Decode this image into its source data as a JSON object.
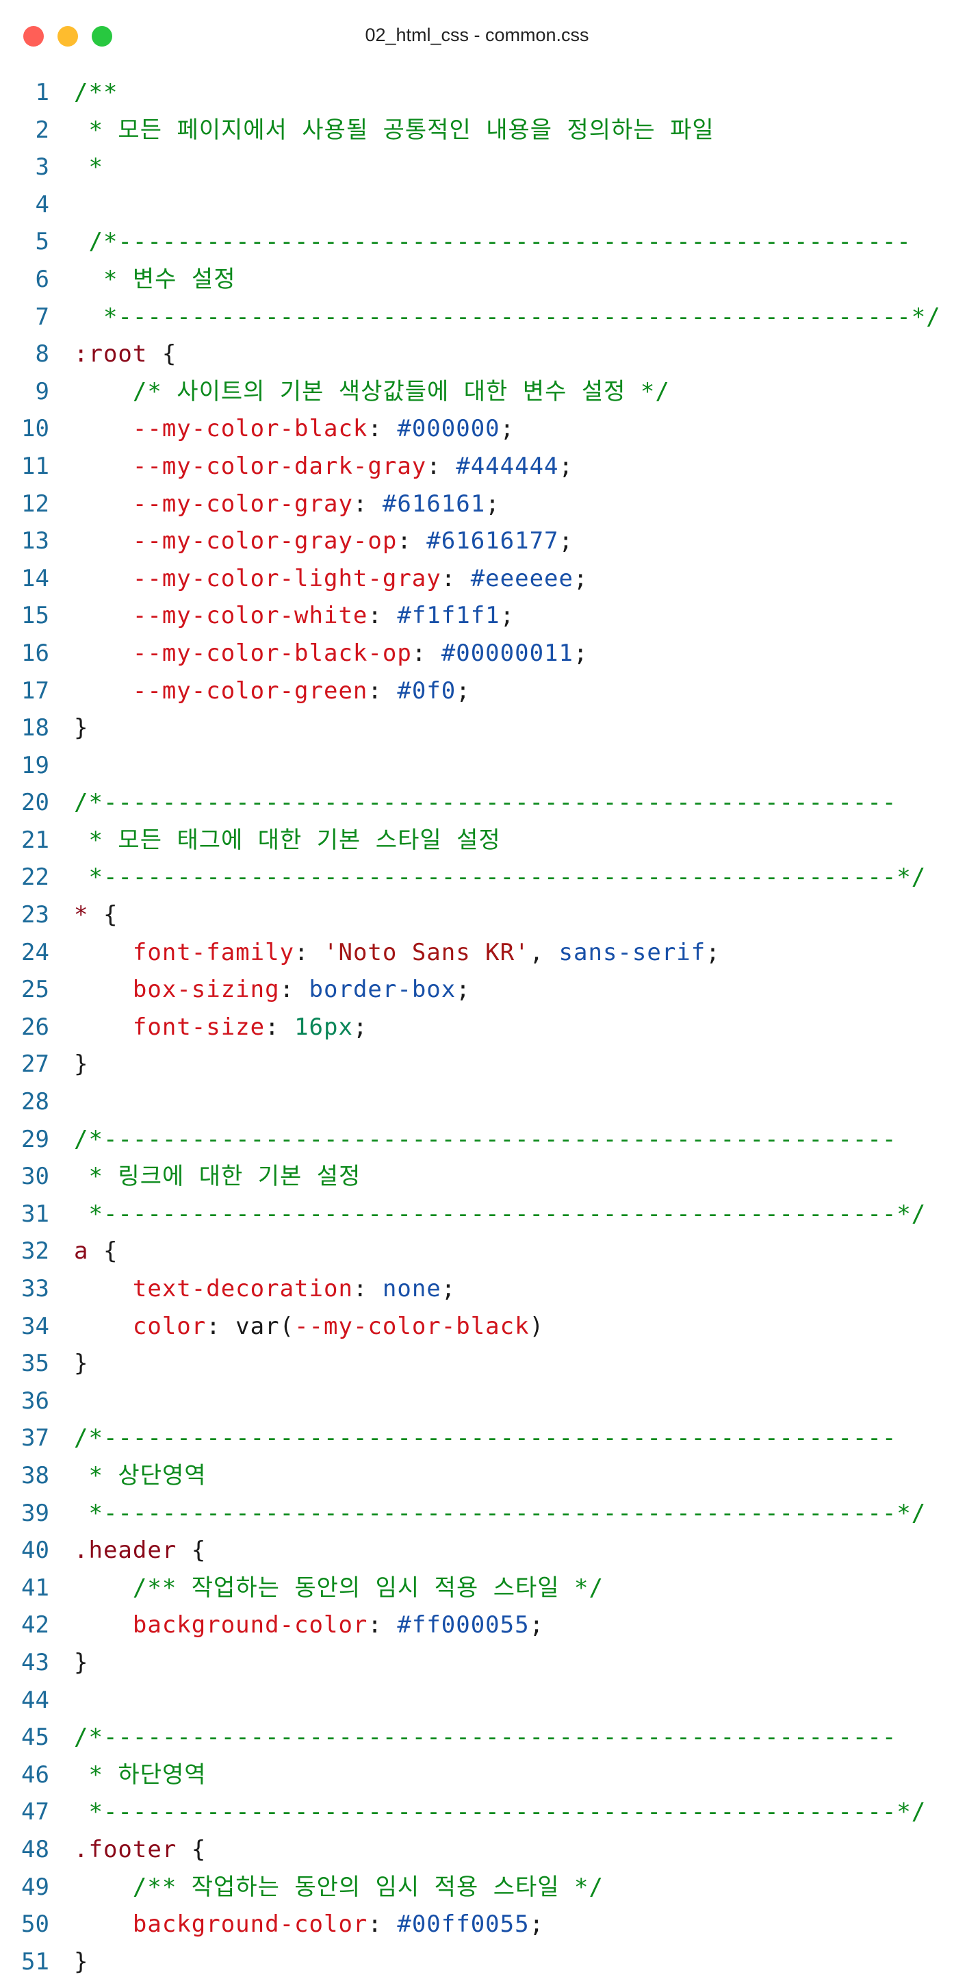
{
  "window": {
    "title": "02_html_css - common.css",
    "controls": [
      {
        "name": "close",
        "color": "#ff5f57"
      },
      {
        "name": "minimize",
        "color": "#febc2e"
      },
      {
        "name": "zoom",
        "color": "#28c840"
      }
    ]
  },
  "token_colors": {
    "line_number": "#1d6b9a",
    "comment": "#0c8a1c",
    "selector": "#8b0a1a",
    "property": "#d1141c",
    "value": "#1850a8",
    "string": "#a31515",
    "number": "#098658",
    "punctuation": "#1a1a1a"
  },
  "lines": [
    {
      "n": "1",
      "tokens": [
        {
          "t": "comment",
          "v": "/**"
        }
      ]
    },
    {
      "n": "2",
      "tokens": [
        {
          "t": "comment",
          "v": " * 모든 페이지에서 사용될 공통적인 내용을 정의하는 파일"
        }
      ]
    },
    {
      "n": "3",
      "tokens": [
        {
          "t": "comment",
          "v": " *"
        }
      ]
    },
    {
      "n": "4",
      "tokens": []
    },
    {
      "n": "5",
      "tokens": [
        {
          "t": "comment",
          "v": " /*------------------------------------------------------"
        }
      ]
    },
    {
      "n": "6",
      "tokens": [
        {
          "t": "comment",
          "v": "  * 변수 설정"
        }
      ]
    },
    {
      "n": "7",
      "tokens": [
        {
          "t": "comment",
          "v": "  *------------------------------------------------------*/"
        }
      ]
    },
    {
      "n": "8",
      "tokens": [
        {
          "t": "selector",
          "v": ":root"
        },
        {
          "t": "punct",
          "v": " {"
        }
      ]
    },
    {
      "n": "9",
      "tokens": [
        {
          "t": "comment",
          "v": "    /* 사이트의 기본 색상값들에 대한 변수 설정 */"
        }
      ]
    },
    {
      "n": "10",
      "tokens": [
        {
          "t": "prop",
          "v": "    --my-color-black"
        },
        {
          "t": "punct",
          "v": ": "
        },
        {
          "t": "value",
          "v": "#000000"
        },
        {
          "t": "punct",
          "v": ";"
        }
      ]
    },
    {
      "n": "11",
      "tokens": [
        {
          "t": "prop",
          "v": "    --my-color-dark-gray"
        },
        {
          "t": "punct",
          "v": ": "
        },
        {
          "t": "value",
          "v": "#444444"
        },
        {
          "t": "punct",
          "v": ";"
        }
      ]
    },
    {
      "n": "12",
      "tokens": [
        {
          "t": "prop",
          "v": "    --my-color-gray"
        },
        {
          "t": "punct",
          "v": ": "
        },
        {
          "t": "value",
          "v": "#616161"
        },
        {
          "t": "punct",
          "v": ";"
        }
      ]
    },
    {
      "n": "13",
      "tokens": [
        {
          "t": "prop",
          "v": "    --my-color-gray-op"
        },
        {
          "t": "punct",
          "v": ": "
        },
        {
          "t": "value",
          "v": "#61616177"
        },
        {
          "t": "punct",
          "v": ";"
        }
      ]
    },
    {
      "n": "14",
      "tokens": [
        {
          "t": "prop",
          "v": "    --my-color-light-gray"
        },
        {
          "t": "punct",
          "v": ": "
        },
        {
          "t": "value",
          "v": "#eeeeee"
        },
        {
          "t": "punct",
          "v": ";"
        }
      ]
    },
    {
      "n": "15",
      "tokens": [
        {
          "t": "prop",
          "v": "    --my-color-white"
        },
        {
          "t": "punct",
          "v": ": "
        },
        {
          "t": "value",
          "v": "#f1f1f1"
        },
        {
          "t": "punct",
          "v": ";"
        }
      ]
    },
    {
      "n": "16",
      "tokens": [
        {
          "t": "prop",
          "v": "    --my-color-black-op"
        },
        {
          "t": "punct",
          "v": ": "
        },
        {
          "t": "value",
          "v": "#00000011"
        },
        {
          "t": "punct",
          "v": ";"
        }
      ]
    },
    {
      "n": "17",
      "tokens": [
        {
          "t": "prop",
          "v": "    --my-color-green"
        },
        {
          "t": "punct",
          "v": ": "
        },
        {
          "t": "value",
          "v": "#0f0"
        },
        {
          "t": "punct",
          "v": ";"
        }
      ]
    },
    {
      "n": "18",
      "tokens": [
        {
          "t": "punct",
          "v": "}"
        }
      ]
    },
    {
      "n": "19",
      "tokens": []
    },
    {
      "n": "20",
      "tokens": [
        {
          "t": "comment",
          "v": "/*------------------------------------------------------"
        }
      ]
    },
    {
      "n": "21",
      "tokens": [
        {
          "t": "comment",
          "v": " * 모든 태그에 대한 기본 스타일 설정"
        }
      ]
    },
    {
      "n": "22",
      "tokens": [
        {
          "t": "comment",
          "v": " *------------------------------------------------------*/"
        }
      ]
    },
    {
      "n": "23",
      "tokens": [
        {
          "t": "selector",
          "v": "*"
        },
        {
          "t": "punct",
          "v": " {"
        }
      ]
    },
    {
      "n": "24",
      "tokens": [
        {
          "t": "prop",
          "v": "    font-family"
        },
        {
          "t": "punct",
          "v": ": "
        },
        {
          "t": "string",
          "v": "'Noto Sans KR'"
        },
        {
          "t": "punct",
          "v": ", "
        },
        {
          "t": "value",
          "v": "sans-serif"
        },
        {
          "t": "punct",
          "v": ";"
        }
      ]
    },
    {
      "n": "25",
      "tokens": [
        {
          "t": "prop",
          "v": "    box-sizing"
        },
        {
          "t": "punct",
          "v": ": "
        },
        {
          "t": "value",
          "v": "border-box"
        },
        {
          "t": "punct",
          "v": ";"
        }
      ]
    },
    {
      "n": "26",
      "tokens": [
        {
          "t": "prop",
          "v": "    font-size"
        },
        {
          "t": "punct",
          "v": ": "
        },
        {
          "t": "number",
          "v": "16px"
        },
        {
          "t": "punct",
          "v": ";"
        }
      ]
    },
    {
      "n": "27",
      "tokens": [
        {
          "t": "punct",
          "v": "}"
        }
      ]
    },
    {
      "n": "28",
      "tokens": []
    },
    {
      "n": "29",
      "tokens": [
        {
          "t": "comment",
          "v": "/*------------------------------------------------------"
        }
      ]
    },
    {
      "n": "30",
      "tokens": [
        {
          "t": "comment",
          "v": " * 링크에 대한 기본 설정"
        }
      ]
    },
    {
      "n": "31",
      "tokens": [
        {
          "t": "comment",
          "v": " *------------------------------------------------------*/"
        }
      ]
    },
    {
      "n": "32",
      "tokens": [
        {
          "t": "selector",
          "v": "a"
        },
        {
          "t": "punct",
          "v": " {"
        }
      ]
    },
    {
      "n": "33",
      "tokens": [
        {
          "t": "prop",
          "v": "    text-decoration"
        },
        {
          "t": "punct",
          "v": ": "
        },
        {
          "t": "value",
          "v": "none"
        },
        {
          "t": "punct",
          "v": ";"
        }
      ]
    },
    {
      "n": "34",
      "tokens": [
        {
          "t": "prop",
          "v": "    color"
        },
        {
          "t": "punct",
          "v": ": var("
        },
        {
          "t": "prop",
          "v": "--my-color-black"
        },
        {
          "t": "punct",
          "v": ")"
        }
      ]
    },
    {
      "n": "35",
      "tokens": [
        {
          "t": "punct",
          "v": "}"
        }
      ]
    },
    {
      "n": "36",
      "tokens": []
    },
    {
      "n": "37",
      "tokens": [
        {
          "t": "comment",
          "v": "/*------------------------------------------------------"
        }
      ]
    },
    {
      "n": "38",
      "tokens": [
        {
          "t": "comment",
          "v": " * 상단영역"
        }
      ]
    },
    {
      "n": "39",
      "tokens": [
        {
          "t": "comment",
          "v": " *------------------------------------------------------*/"
        }
      ]
    },
    {
      "n": "40",
      "tokens": [
        {
          "t": "selector",
          "v": ".header"
        },
        {
          "t": "punct",
          "v": " {"
        }
      ]
    },
    {
      "n": "41",
      "tokens": [
        {
          "t": "comment",
          "v": "    /** 작업하는 동안의 임시 적용 스타일 */"
        }
      ]
    },
    {
      "n": "42",
      "tokens": [
        {
          "t": "prop",
          "v": "    background-color"
        },
        {
          "t": "punct",
          "v": ": "
        },
        {
          "t": "value",
          "v": "#ff000055"
        },
        {
          "t": "punct",
          "v": ";"
        }
      ]
    },
    {
      "n": "43",
      "tokens": [
        {
          "t": "punct",
          "v": "}"
        }
      ]
    },
    {
      "n": "44",
      "tokens": []
    },
    {
      "n": "45",
      "tokens": [
        {
          "t": "comment",
          "v": "/*------------------------------------------------------"
        }
      ]
    },
    {
      "n": "46",
      "tokens": [
        {
          "t": "comment",
          "v": " * 하단영역"
        }
      ]
    },
    {
      "n": "47",
      "tokens": [
        {
          "t": "comment",
          "v": " *------------------------------------------------------*/"
        }
      ]
    },
    {
      "n": "48",
      "tokens": [
        {
          "t": "selector",
          "v": ".footer"
        },
        {
          "t": "punct",
          "v": " {"
        }
      ]
    },
    {
      "n": "49",
      "tokens": [
        {
          "t": "comment",
          "v": "    /** 작업하는 동안의 임시 적용 스타일 */"
        }
      ]
    },
    {
      "n": "50",
      "tokens": [
        {
          "t": "prop",
          "v": "    background-color"
        },
        {
          "t": "punct",
          "v": ": "
        },
        {
          "t": "value",
          "v": "#00ff0055"
        },
        {
          "t": "punct",
          "v": ";"
        }
      ]
    },
    {
      "n": "51",
      "tokens": [
        {
          "t": "punct",
          "v": "}"
        }
      ]
    }
  ]
}
